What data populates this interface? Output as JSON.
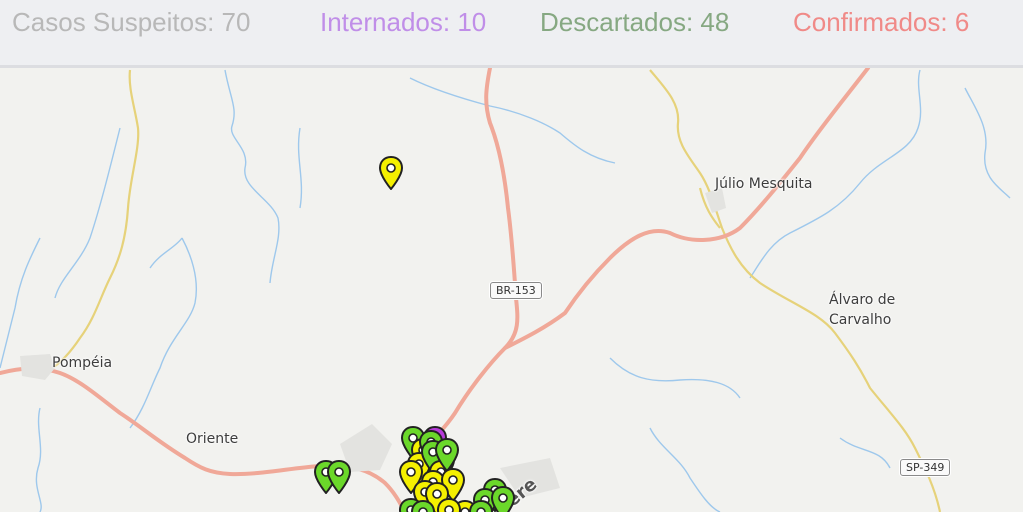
{
  "stats": {
    "suspeitos": {
      "label": "Casos Suspeitos: 70",
      "color": "#b8b8b8"
    },
    "internados": {
      "label": "Internados: 10",
      "color": "#c08ee8"
    },
    "descartados": {
      "label": "Descartados: 48",
      "color": "#86a882"
    },
    "confirmados": {
      "label": "Confirmados: 6",
      "color": "#f08a88"
    }
  },
  "map": {
    "places": {
      "julio_mesquita": "Júlio Mesquita",
      "alvaro_line1": "Álvaro de",
      "alvaro_line2": "Carvalho",
      "pompeia": "Pompéia",
      "oriente": "Oriente",
      "marilia_partial": "ere"
    },
    "shields": {
      "br153": "BR-153",
      "sp349": "SP-349"
    },
    "colors": {
      "highway": "#f0a898",
      "secondary_road": "#e6d27a",
      "river": "#9ec8ec",
      "land": "#f2f2ef",
      "marker_yellow": "#f5f000",
      "marker_green": "#6bd82a",
      "marker_purple": "#b63ad9"
    },
    "marker_icons": [
      "map-pin-yellow",
      "map-pin-green",
      "map-pin-purple"
    ]
  }
}
